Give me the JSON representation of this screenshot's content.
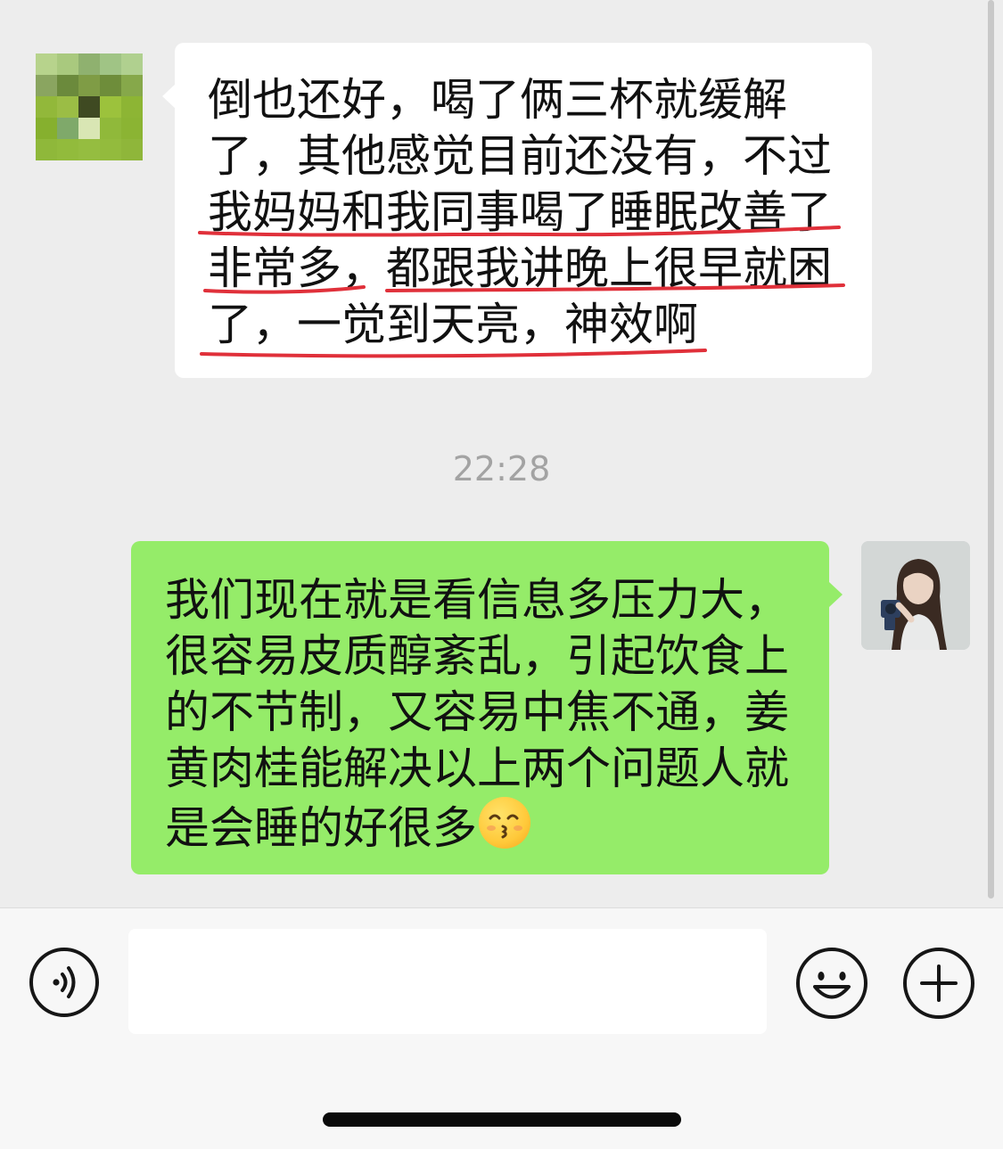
{
  "messages": [
    {
      "direction": "incoming",
      "lines": [
        "倒也还好，喝了俩三杯就缓解",
        "了，其他感觉目前还没有，不过",
        "我妈妈和我同事喝了睡眠改善了",
        "非常多，都跟我讲晚上很早就困",
        "了，一觉到天亮，神效啊"
      ],
      "bubble_color": "#ffffff",
      "annotation_color": "#e0303a"
    },
    {
      "direction": "outgoing",
      "lines": [
        "我们现在就是看信息多压力大，",
        "很容易皮质醇紊乱，引起饮食上",
        "的不节制，又容易中焦不通，姜",
        "黄肉桂能解决以上两个问题人就",
        "是会睡的好很多"
      ],
      "trailing_emoji": "kissing-face-with-smiling-eyes",
      "bubble_color": "#95ec69"
    }
  ],
  "timestamp": "22:28",
  "input_bar": {
    "input_value": "",
    "icons": [
      "voice-icon",
      "emoji-icon",
      "plus-icon"
    ]
  }
}
